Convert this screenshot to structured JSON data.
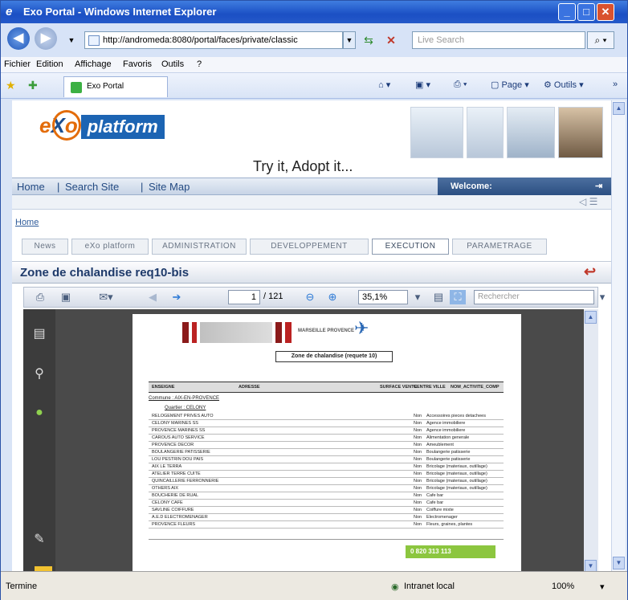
{
  "window": {
    "title": "Exo Portal - Windows Internet Explorer"
  },
  "address": {
    "url": "http://andromeda:8080/portal/faces/private/classic",
    "search_placeholder": "Live Search"
  },
  "menu": [
    "Fichier",
    "Edition",
    "Affichage",
    "Favoris",
    "Outils",
    "?"
  ],
  "favorites": {
    "tab_label": "Exo Portal",
    "cmd_page": "Page",
    "cmd_tools": "Outils"
  },
  "portal": {
    "logo_text": "platform",
    "slogan": "Try it, Adopt it...",
    "nav": [
      "Home",
      "|",
      "Search Site",
      "|",
      "Site Map"
    ],
    "welcome": "Welcome:",
    "breadcrumb": "Home",
    "tabs": [
      "News",
      "eXo platform",
      "ADMINISTRATION",
      "DEVELOPPEMENT",
      "EXECUTION",
      "PARAMETRAGE"
    ],
    "selected_tab": 4,
    "zone_title": "Zone de chalandise req10-bis"
  },
  "pdf": {
    "page_current": "1",
    "page_total": "/ 121",
    "zoom": "35,1%",
    "search_placeholder": "Rechercher",
    "doc_title": "Zone de chalandise (requete 10)",
    "brand": "MARSEILLE PROVENCE",
    "columns": [
      "ENSEIGNE",
      "ADRESSE",
      "SURFACE VENTE",
      "CENTRE VILLE",
      "NOM_ACTIVITE_COMP"
    ],
    "group1": "Commune : AIX-EN-PROVENCE",
    "group2": "Quartier : CELONY",
    "rows": [
      [
        "RELOGEMENT PRIVES AUTO",
        "Non",
        "Accessoires pieces detachees"
      ],
      [
        "CELONY MARINES SS",
        "Non",
        "Agence immobiliere"
      ],
      [
        "PROVENCE MARINES SS",
        "Non",
        "Agence immobiliere"
      ],
      [
        "CAROUS AUTO SERVICE",
        "Non",
        "Alimentation generale"
      ],
      [
        "PROVENCE DECOR",
        "Non",
        "Ameublement"
      ],
      [
        "BOULANGERIE PATISSERIE",
        "Non",
        "Boulangerie patisserie"
      ],
      [
        "LOU PESTRIN DOU PAIS",
        "Non",
        "Boulangerie patisserie"
      ],
      [
        "AIX LE TERRA",
        "Non",
        "Bricolage (materiaux, outillage)"
      ],
      [
        "ATELIER TERRE CUITE",
        "Non",
        "Bricolage (materiaux, outillage)"
      ],
      [
        "QUINCAILLERIE FERRONNERIE",
        "Non",
        "Bricolage (materiaux, outillage)"
      ],
      [
        "OTHERS AIX",
        "Non",
        "Bricolage (materiaux, outillage)"
      ],
      [
        "BOUCHERIE DE RUAL",
        "Non",
        "Cafe bar"
      ],
      [
        "CELONY CAFE",
        "Non",
        "Cafe bar"
      ],
      [
        "SAVLINE COIFFURE",
        "Non",
        "Coiffure mixte"
      ],
      [
        "A.E.D ELECTROMENAGER",
        "Non",
        "Electromenager"
      ],
      [
        "PROVENCE FLEURS",
        "Non",
        "Fleurs, graines, plantes"
      ]
    ],
    "footer_phone": "0 820 313 113"
  },
  "status": {
    "left": "Termine",
    "zone": "Intranet local",
    "zoom": "100%"
  }
}
